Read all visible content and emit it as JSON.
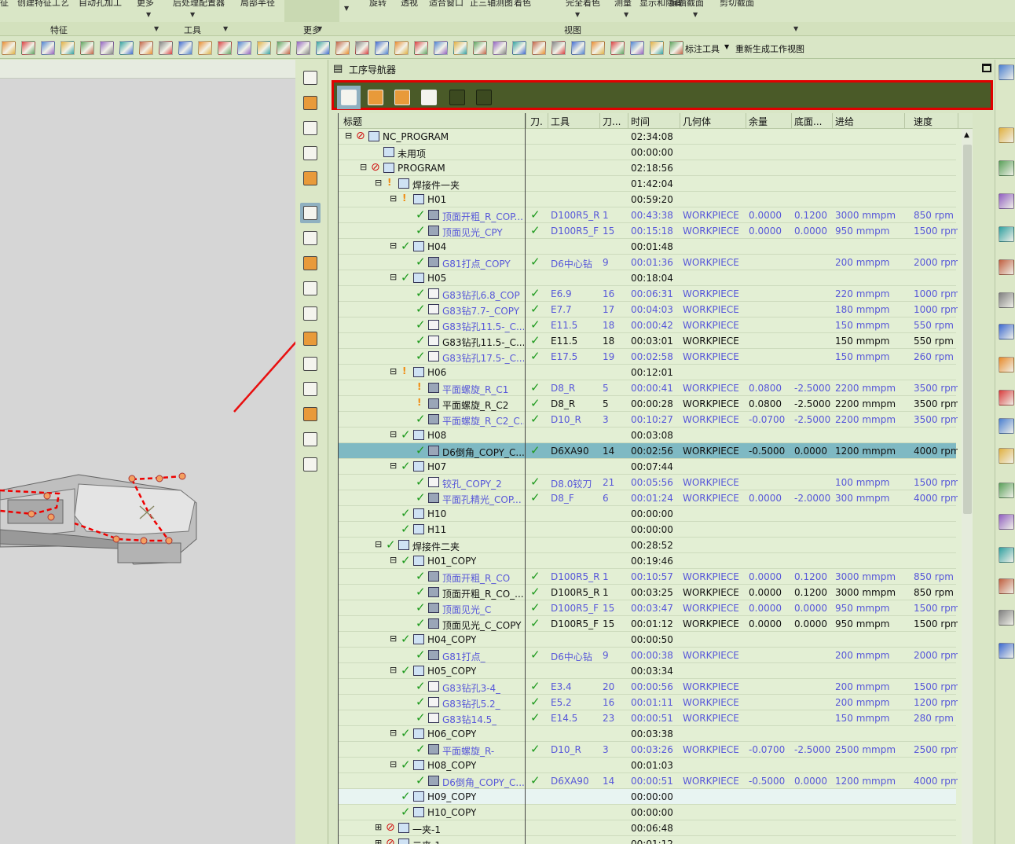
{
  "ribbon": {
    "top_items": [
      "征",
      "创建特征工艺",
      "自动孔加工",
      "更多",
      "后处理配置器",
      "局部半径",
      "旋转",
      "透视",
      "适合窗口",
      "正三轴测图",
      "着色",
      "完全着色",
      "测量",
      "显示和隐藏",
      "编辑截面",
      "剪切截面"
    ],
    "groups": [
      "特征",
      "工具",
      "更多",
      "视图"
    ],
    "annot_tool": "标注工具",
    "regen_view": "重新生成工作视图"
  },
  "navigator": {
    "title": "工序导航器"
  },
  "columns": [
    "标题",
    "刀.",
    "工具",
    "刀...",
    "时间",
    "几何体",
    "余量",
    "底面...",
    "进给",
    "速度"
  ],
  "rows": [
    {
      "level": 0,
      "exp": "⊟",
      "icon": "prog-na",
      "title": "NC_PROGRAM",
      "time": "02:34:08"
    },
    {
      "level": 1,
      "exp": "",
      "icon": "folder",
      "title": "未用项",
      "time": "00:00:00"
    },
    {
      "level": 1,
      "exp": "⊟",
      "icon": "prog-na",
      "title": "PROGRAM",
      "time": "02:18:56"
    },
    {
      "level": 2,
      "exp": "⊟",
      "icon": "folder-warn",
      "title": "焊接件一夹",
      "time": "01:42:04"
    },
    {
      "level": 3,
      "exp": "⊟",
      "icon": "folder-warn",
      "title": "H01",
      "time": "00:59:20"
    },
    {
      "level": 4,
      "exp": "",
      "icon": "op",
      "title": "顶面开粗_R_COP...",
      "ok": "✓",
      "tool": "D100R5_R",
      "tn": "1",
      "time": "00:43:38",
      "geom": "WORKPIECE",
      "stock": "0.0000",
      "floor": "0.1200",
      "feed": "3000 mmpm",
      "speed": "850 rpm",
      "c": "blue"
    },
    {
      "level": 4,
      "exp": "",
      "icon": "op",
      "title": "顶面见光_CPY",
      "ok": "✓",
      "tool": "D100R5_F",
      "tn": "15",
      "time": "00:15:18",
      "geom": "WORKPIECE",
      "stock": "0.0000",
      "floor": "0.0000",
      "feed": "950 mmpm",
      "speed": "1500 rpm",
      "c": "blue"
    },
    {
      "level": 3,
      "exp": "⊟",
      "icon": "folder-ok",
      "title": "H04",
      "time": "00:01:48"
    },
    {
      "level": 4,
      "exp": "",
      "icon": "op",
      "title": "G81打点_COPY",
      "ok": "✓",
      "tool": "D6中心钻",
      "tn": "9",
      "time": "00:01:36",
      "geom": "WORKPIECE",
      "feed": "200 mmpm",
      "speed": "2000 rpm",
      "c": "blue"
    },
    {
      "level": 3,
      "exp": "⊟",
      "icon": "folder-ok",
      "title": "H05",
      "time": "00:18:04"
    },
    {
      "level": 4,
      "exp": "",
      "icon": "drill",
      "title": "G83钻孔6.8_COP",
      "ok": "✓",
      "tool": "E6.9",
      "tn": "16",
      "time": "00:06:31",
      "geom": "WORKPIECE",
      "feed": "220 mmpm",
      "speed": "1000 rpm",
      "c": "blue"
    },
    {
      "level": 4,
      "exp": "",
      "icon": "drill",
      "title": "G83钻7.7-_COPY",
      "ok": "✓",
      "tool": "E7.7",
      "tn": "17",
      "time": "00:04:03",
      "geom": "WORKPIECE",
      "feed": "180 mmpm",
      "speed": "1000 rpm",
      "c": "blue"
    },
    {
      "level": 4,
      "exp": "",
      "icon": "drill",
      "title": "G83钻孔11.5-_C...",
      "ok": "✓",
      "tool": "E11.5",
      "tn": "18",
      "time": "00:00:42",
      "geom": "WORKPIECE",
      "feed": "150 mmpm",
      "speed": "550 rpm",
      "c": "blue"
    },
    {
      "level": 4,
      "exp": "",
      "icon": "drill",
      "title": "G83钻孔11.5-_C...",
      "ok": "✓",
      "tool": "E11.5",
      "tn": "18",
      "time": "00:03:01",
      "geom": "WORKPIECE",
      "feed": "150 mmpm",
      "speed": "550 rpm",
      "c": "blk"
    },
    {
      "level": 4,
      "exp": "",
      "icon": "drill",
      "title": "G83钻孔17.5-_C...",
      "ok": "✓",
      "tool": "E17.5",
      "tn": "19",
      "time": "00:02:58",
      "geom": "WORKPIECE",
      "feed": "150 mmpm",
      "speed": "260 rpm",
      "c": "blue"
    },
    {
      "level": 3,
      "exp": "⊟",
      "icon": "folder-warn",
      "title": "H06",
      "time": "00:12:01"
    },
    {
      "level": 4,
      "exp": "",
      "icon": "op-warn",
      "title": "平面螺旋_R_C1",
      "ok": "✓",
      "tool": "D8_R",
      "tn": "5",
      "time": "00:00:41",
      "geom": "WORKPIECE",
      "stock": "0.0800",
      "floor": "-2.5000",
      "feed": "2200 mmpm",
      "speed": "3500 rpm",
      "c": "blue"
    },
    {
      "level": 4,
      "exp": "",
      "icon": "op-warn",
      "title": "平面螺旋_R_C2",
      "ok": "✓",
      "tool": "D8_R",
      "tn": "5",
      "time": "00:00:28",
      "geom": "WORKPIECE",
      "stock": "0.0800",
      "floor": "-2.5000",
      "feed": "2200 mmpm",
      "speed": "3500 rpm",
      "c": "blk"
    },
    {
      "level": 4,
      "exp": "",
      "icon": "op",
      "title": "平面螺旋_R_C2_C...",
      "ok": "✓",
      "tool": "D10_R",
      "tn": "3",
      "time": "00:10:27",
      "geom": "WORKPIECE",
      "stock": "-0.0700",
      "floor": "-2.5000",
      "feed": "2200 mmpm",
      "speed": "3500 rpm",
      "c": "blue"
    },
    {
      "level": 3,
      "exp": "⊟",
      "icon": "folder-ok",
      "title": "H08",
      "time": "00:03:08"
    },
    {
      "level": 4,
      "exp": "",
      "icon": "op",
      "title": "D6倒角_COPY_C...",
      "ok": "✓",
      "tool": "D6XA90",
      "tn": "14",
      "time": "00:02:56",
      "geom": "WORKPIECE",
      "stock": "-0.5000",
      "floor": "0.0000",
      "feed": "1200 mmpm",
      "speed": "4000 rpm",
      "c": "blk",
      "sel": true
    },
    {
      "level": 3,
      "exp": "⊟",
      "icon": "folder-ok",
      "title": "H07",
      "time": "00:07:44"
    },
    {
      "level": 4,
      "exp": "",
      "icon": "drill",
      "title": "铰孔_COPY_2",
      "ok": "✓",
      "tool": "D8.0铰刀",
      "tn": "21",
      "time": "00:05:56",
      "geom": "WORKPIECE",
      "feed": "100 mmpm",
      "speed": "1500 rpm",
      "c": "blue"
    },
    {
      "level": 4,
      "exp": "",
      "icon": "op",
      "title": "平面孔精光_COP...",
      "ok": "✓",
      "tool": "D8_F",
      "tn": "6",
      "time": "00:01:24",
      "geom": "WORKPIECE",
      "stock": "0.0000",
      "floor": "-2.0000",
      "feed": "300 mmpm",
      "speed": "4000 rpm",
      "c": "blue"
    },
    {
      "level": 3,
      "exp": "",
      "icon": "folder-ok",
      "title": "H10",
      "time": "00:00:00"
    },
    {
      "level": 3,
      "exp": "",
      "icon": "folder-ok",
      "title": "H11",
      "time": "00:00:00"
    },
    {
      "level": 2,
      "exp": "⊟",
      "icon": "folder-ok",
      "title": "焊接件二夹",
      "time": "00:28:52"
    },
    {
      "level": 3,
      "exp": "⊟",
      "icon": "folder-ok",
      "title": "H01_COPY",
      "time": "00:19:46"
    },
    {
      "level": 4,
      "exp": "",
      "icon": "op",
      "title": "顶面开粗_R_CO",
      "ok": "✓",
      "tool": "D100R5_R",
      "tn": "1",
      "time": "00:10:57",
      "geom": "WORKPIECE",
      "stock": "0.0000",
      "floor": "0.1200",
      "feed": "3000 mmpm",
      "speed": "850 rpm",
      "c": "blue"
    },
    {
      "level": 4,
      "exp": "",
      "icon": "op",
      "title": "顶面开粗_R_CO_...",
      "ok": "✓",
      "tool": "D100R5_R",
      "tn": "1",
      "time": "00:03:25",
      "geom": "WORKPIECE",
      "stock": "0.0000",
      "floor": "0.1200",
      "feed": "3000 mmpm",
      "speed": "850 rpm",
      "c": "blk"
    },
    {
      "level": 4,
      "exp": "",
      "icon": "op",
      "title": "顶面见光_C",
      "ok": "✓",
      "tool": "D100R5_F",
      "tn": "15",
      "time": "00:03:47",
      "geom": "WORKPIECE",
      "stock": "0.0000",
      "floor": "0.0000",
      "feed": "950 mmpm",
      "speed": "1500 rpm",
      "c": "blue"
    },
    {
      "level": 4,
      "exp": "",
      "icon": "op",
      "title": "顶面见光_C_COPY",
      "ok": "✓",
      "tool": "D100R5_F",
      "tn": "15",
      "time": "00:01:12",
      "geom": "WORKPIECE",
      "stock": "0.0000",
      "floor": "0.0000",
      "feed": "950 mmpm",
      "speed": "1500 rpm",
      "c": "blk"
    },
    {
      "level": 3,
      "exp": "⊟",
      "icon": "folder-ok",
      "title": "H04_COPY",
      "time": "00:00:50"
    },
    {
      "level": 4,
      "exp": "",
      "icon": "op",
      "title": "G81打点_",
      "ok": "✓",
      "tool": "D6中心钻",
      "tn": "9",
      "time": "00:00:38",
      "geom": "WORKPIECE",
      "feed": "200 mmpm",
      "speed": "2000 rpm",
      "c": "blue"
    },
    {
      "level": 3,
      "exp": "⊟",
      "icon": "folder-ok",
      "title": "H05_COPY",
      "time": "00:03:34"
    },
    {
      "level": 4,
      "exp": "",
      "icon": "drill",
      "title": "G83钻孔3-4_",
      "ok": "✓",
      "tool": "E3.4",
      "tn": "20",
      "time": "00:00:56",
      "geom": "WORKPIECE",
      "feed": "200 mmpm",
      "speed": "1500 rpm",
      "c": "blue"
    },
    {
      "level": 4,
      "exp": "",
      "icon": "drill",
      "title": "G83钻孔5.2_",
      "ok": "✓",
      "tool": "E5.2",
      "tn": "16",
      "time": "00:01:11",
      "geom": "WORKPIECE",
      "feed": "200 mmpm",
      "speed": "1200 rpm",
      "c": "blue"
    },
    {
      "level": 4,
      "exp": "",
      "icon": "drill",
      "title": "G83钻14.5_",
      "ok": "✓",
      "tool": "E14.5",
      "tn": "23",
      "time": "00:00:51",
      "geom": "WORKPIECE",
      "feed": "150 mmpm",
      "speed": "280 rpm",
      "c": "blue"
    },
    {
      "level": 3,
      "exp": "⊟",
      "icon": "folder-ok",
      "title": "H06_COPY",
      "time": "00:03:38"
    },
    {
      "level": 4,
      "exp": "",
      "icon": "op",
      "title": "平面螺旋_R-",
      "ok": "✓",
      "tool": "D10_R",
      "tn": "3",
      "time": "00:03:26",
      "geom": "WORKPIECE",
      "stock": "-0.0700",
      "floor": "-2.5000",
      "feed": "2500 mmpm",
      "speed": "2500 rpm",
      "c": "blue"
    },
    {
      "level": 3,
      "exp": "⊟",
      "icon": "folder-ok",
      "title": "H08_COPY",
      "time": "00:01:03"
    },
    {
      "level": 4,
      "exp": "",
      "icon": "op",
      "title": "D6倒角_COPY_C...",
      "ok": "✓",
      "tool": "D6XA90",
      "tn": "14",
      "time": "00:00:51",
      "geom": "WORKPIECE",
      "stock": "-0.5000",
      "floor": "0.0000",
      "feed": "1200 mmpm",
      "speed": "4000 rpm",
      "c": "blue"
    },
    {
      "level": 3,
      "exp": "",
      "icon": "folder-ok",
      "title": "H09_COPY",
      "time": "00:00:00",
      "hl": true
    },
    {
      "level": 3,
      "exp": "",
      "icon": "folder-ok",
      "title": "H10_COPY",
      "time": "00:00:00"
    },
    {
      "level": 2,
      "exp": "⊞",
      "icon": "prog-na",
      "title": "一夹-1",
      "time": "00:06:48"
    },
    {
      "level": 2,
      "exp": "⊞",
      "icon": "prog-na",
      "title": "二夹-1",
      "time": "00:01:12"
    }
  ]
}
